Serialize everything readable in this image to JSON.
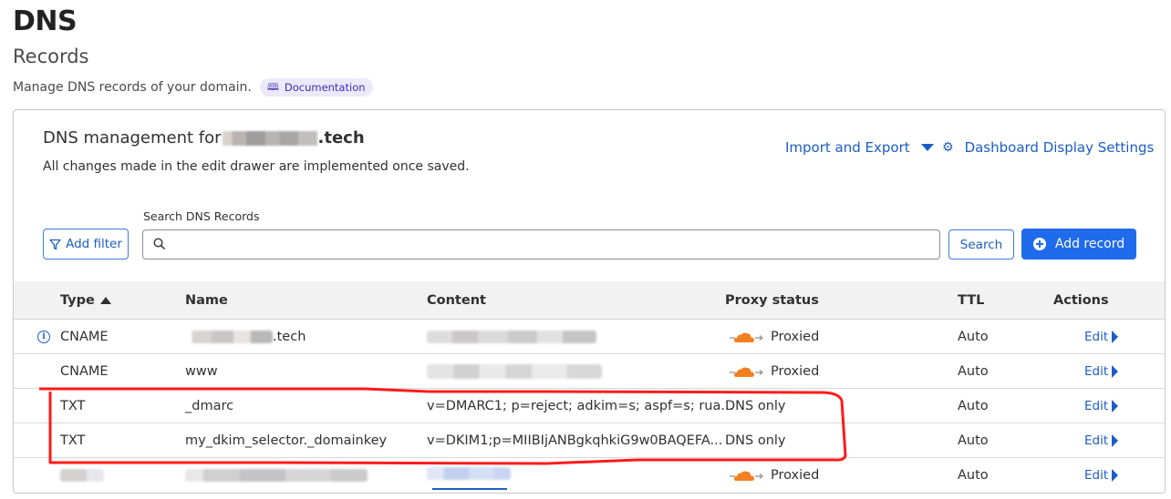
{
  "page": {
    "title": "DNS",
    "subtitle": "Records",
    "description": "Manage DNS records of your domain.",
    "documentation_label": "Documentation"
  },
  "card": {
    "title_prefix": "DNS management for",
    "title_suffix": ".tech",
    "description": "All changes made in the edit drawer are implemented once saved.",
    "import_export_label": "Import and Export",
    "display_settings_label": "Dashboard Display Settings"
  },
  "toolbar": {
    "add_filter_label": "Add filter",
    "search_label": "Search DNS Records",
    "search_value": "",
    "search_placeholder": "",
    "search_button_label": "Search",
    "add_record_label": "Add record"
  },
  "table": {
    "columns": [
      "Type",
      "Name",
      "Content",
      "Proxy status",
      "TTL",
      "Actions"
    ],
    "sort_column": "Type",
    "sort_direction": "ascending",
    "rows": [
      {
        "type": "CNAME",
        "name": ".tech",
        "name_redacted": true,
        "content": "",
        "content_redacted": true,
        "proxy_status": "Proxied",
        "ttl": "Auto",
        "action": "Edit",
        "info": true
      },
      {
        "type": "CNAME",
        "name": "www",
        "content": "",
        "content_redacted": true,
        "proxy_status": "Proxied",
        "ttl": "Auto",
        "action": "Edit"
      },
      {
        "type": "TXT",
        "name": "_dmarc",
        "content": "v=DMARC1; p=reject; adkim=s; aspf=s; rua...",
        "proxy_status": "DNS only",
        "ttl": "Auto",
        "action": "Edit"
      },
      {
        "type": "TXT",
        "name": "my_dkim_selector._domainkey",
        "content": "v=DKIM1;p=MIIBIjANBgkqhkiG9w0BAQEFA...",
        "proxy_status": "DNS only",
        "ttl": "Auto",
        "action": "Edit"
      },
      {
        "type": "",
        "type_redacted": true,
        "name": "",
        "name_redacted": true,
        "content": "",
        "content_redacted": true,
        "proxy_status": "Proxied",
        "ttl": "Auto",
        "action": "Edit"
      }
    ]
  },
  "colors": {
    "link": "#1c5dc5",
    "primary_button": "#1f6bec",
    "proxy_cloud": "#f38020",
    "annotation": "#ff1a1a",
    "doc_badge_bg": "#ece9fb"
  },
  "annotation": {
    "type": "red-outline",
    "highlights_rows": [
      "_dmarc",
      "my_dkim_selector._domainkey"
    ]
  }
}
